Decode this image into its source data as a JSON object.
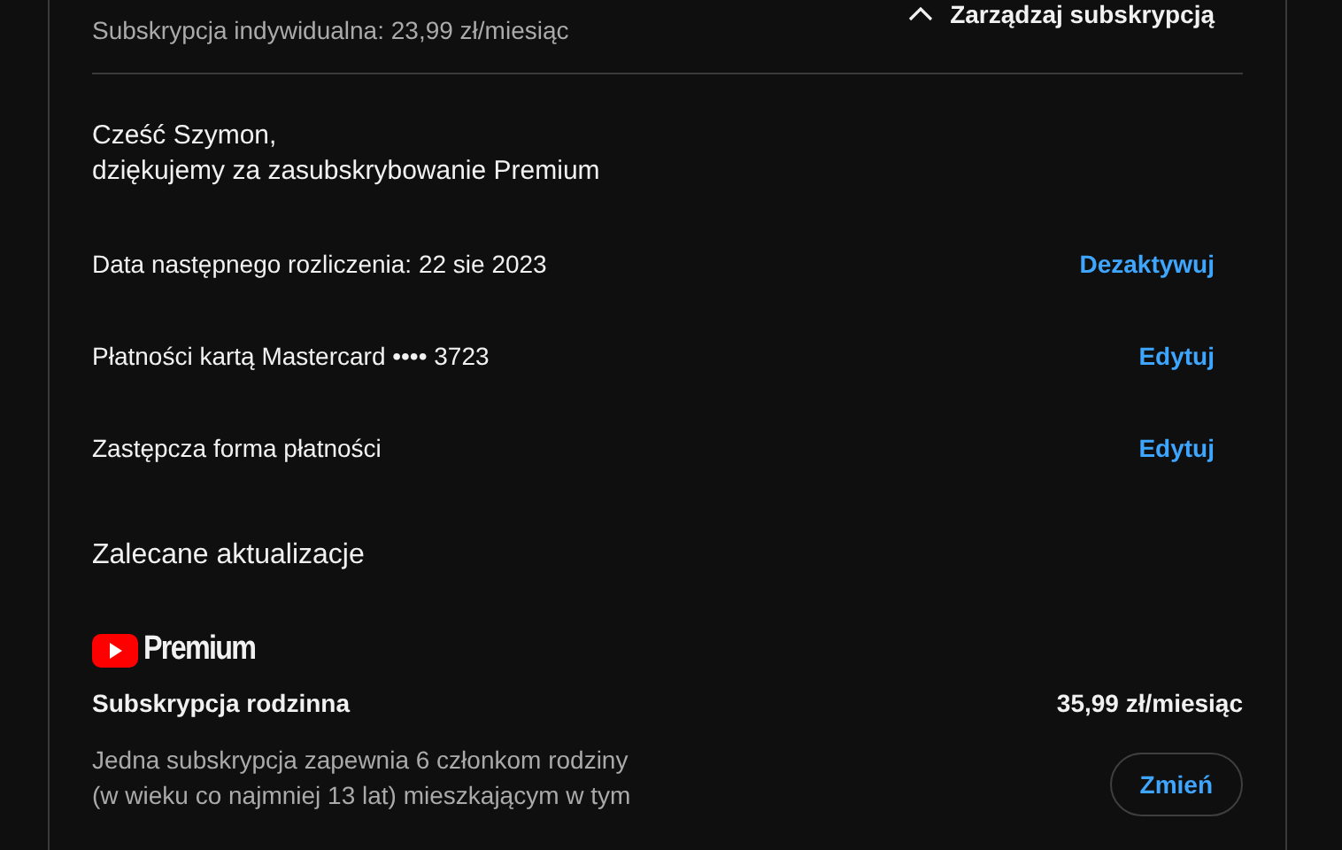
{
  "header": {
    "plan": "Subskrypcja indywidualna: 23,99 zł/miesiąc",
    "manage_button": {
      "label": "Zarządzaj subskrypcją",
      "expanded": true
    }
  },
  "greeting": [
    "Cześć Szymon,",
    "dziękujemy za zasubskrybowanie Premium"
  ],
  "rows": [
    {
      "label": "Data następnego rozliczenia: 22 sie 2023",
      "action": "Dezaktywuj"
    },
    {
      "label": "Płatności kartą Mastercard •••• 3723",
      "action": "Edytuj"
    },
    {
      "label": "Zastępcza forma płatności",
      "action": "Edytuj"
    }
  ],
  "recommended": {
    "title": "Zalecane aktualizacje",
    "logo_text": "Premium",
    "plan_name": "Subskrypcja rodzinna",
    "price": "35,99 zł/miesiąc",
    "description": "Jedna subskrypcja zapewnia 6 członkom rodziny (w wieku co najmniej 13 lat) mieszkającym w tym",
    "button": "Zmień"
  }
}
